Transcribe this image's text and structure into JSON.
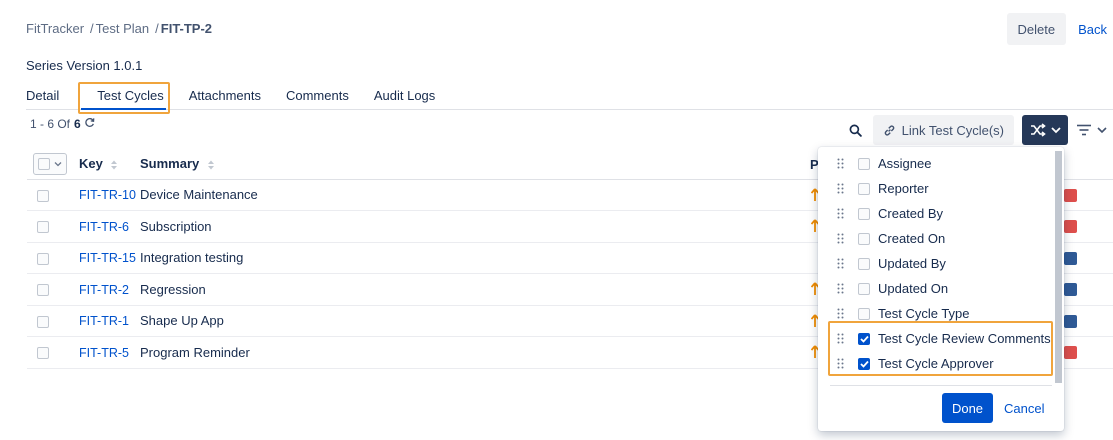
{
  "breadcrumb": {
    "app": "FitTracker",
    "section": "Test Plan",
    "current": "FIT-TP-2",
    "sep": "/"
  },
  "actions": {
    "delete_label": "Delete",
    "back_label": "Back"
  },
  "version_label": "Series Version 1.0.1",
  "tabs": [
    {
      "label": "Detail"
    },
    {
      "label": "Test Cycles"
    },
    {
      "label": "Attachments"
    },
    {
      "label": "Comments"
    },
    {
      "label": "Audit Logs"
    }
  ],
  "active_tab": "Test Cycles",
  "count": {
    "range": "1 - 6 Of",
    "total": "6",
    "refresh_icon": "refresh-icon"
  },
  "toolbar": {
    "link_label": "Link Test Cycle(s)",
    "search_icon": "search-icon",
    "shuffle_icon": "shuffle-icon",
    "filter_icon": "filter-icon"
  },
  "table": {
    "columns": {
      "key": "Key",
      "summary": "Summary",
      "priority": "P"
    },
    "rows": [
      {
        "key": "FIT-TR-10",
        "summary": "Device Maintenance",
        "priority_shown": true,
        "status_color": "#de4f4c"
      },
      {
        "key": "FIT-TR-6",
        "summary": "Subscription",
        "priority_shown": true,
        "status_color": "#de4f4c"
      },
      {
        "key": "FIT-TR-15",
        "summary": "Integration testing",
        "priority_shown": false,
        "status_color": "#2f5a96"
      },
      {
        "key": "FIT-TR-2",
        "summary": "Regression",
        "priority_shown": true,
        "status_color": "#2f5a96"
      },
      {
        "key": "FIT-TR-1",
        "summary": "Shape Up App",
        "priority_shown": true,
        "status_color": "#2f5a96"
      },
      {
        "key": "FIT-TR-5",
        "summary": "Program Reminder",
        "priority_shown": true,
        "status_color": "#de4f4c"
      }
    ]
  },
  "column_picker": {
    "items": [
      {
        "label": "Assignee",
        "checked": false
      },
      {
        "label": "Reporter",
        "checked": false
      },
      {
        "label": "Created By",
        "checked": false
      },
      {
        "label": "Created On",
        "checked": false
      },
      {
        "label": "Updated By",
        "checked": false
      },
      {
        "label": "Updated On",
        "checked": false
      },
      {
        "label": "Test Cycle Type",
        "checked": false
      },
      {
        "label": "Test Cycle Review Comments",
        "checked": true
      },
      {
        "label": "Test Cycle Approver",
        "checked": true
      }
    ],
    "done_label": "Done",
    "cancel_label": "Cancel"
  },
  "colors": {
    "accent": "#0052cc",
    "highlight": "#f0a43c",
    "dark_button": "#253858",
    "priority_arrow": "#f08c00"
  }
}
